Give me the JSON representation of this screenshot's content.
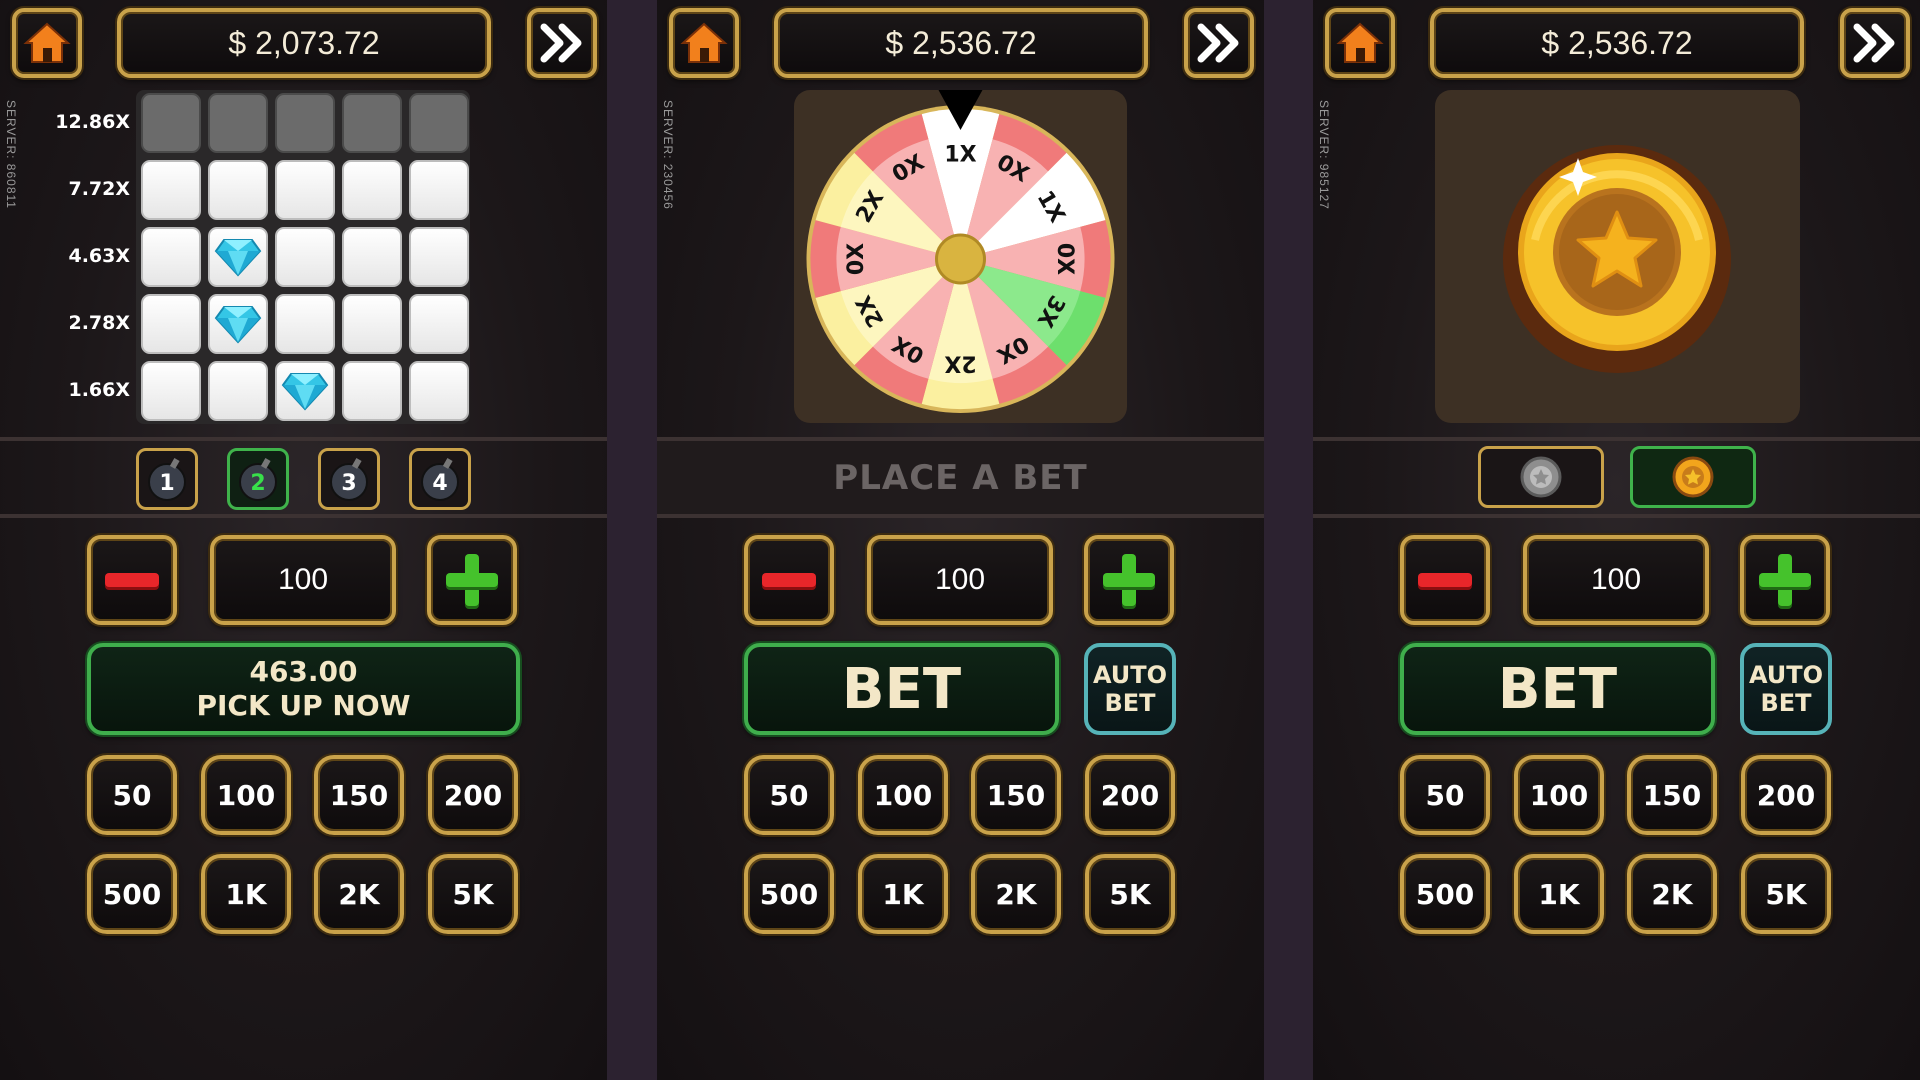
{
  "panels": {
    "mines": {
      "balance": "$  2,073.72",
      "server": "SERVER: 860811",
      "multipliers": [
        "12.86X",
        "7.72X",
        "4.63X",
        "2.78X",
        "1.66X"
      ],
      "bomb_options": [
        "1",
        "2",
        "3",
        "4"
      ],
      "selected_bombs": "2",
      "bet_amount": "100",
      "pickup_amount": "463.00",
      "pickup_label": "PICK UP NOW",
      "chips": [
        "50",
        "100",
        "150",
        "200",
        "500",
        "1K",
        "2K",
        "5K"
      ]
    },
    "wheel": {
      "balance": "$  2,536.72",
      "server": "SERVER: 230456",
      "status": "PLACE A BET",
      "bet_amount": "100",
      "bet_label": "BET",
      "auto_bet": [
        "AUTO",
        "BET"
      ],
      "chips": [
        "50",
        "100",
        "150",
        "200",
        "500",
        "1K",
        "2K",
        "5K"
      ],
      "segments": [
        "1X",
        "0X",
        "1X",
        "0X",
        "3X",
        "0X",
        "2X",
        "0X",
        "2X",
        "0X",
        "2X",
        "0X"
      ]
    },
    "coinflip": {
      "balance": "$  2,536.72",
      "server": "SERVER: 985127",
      "bet_amount": "100",
      "bet_label": "BET",
      "auto_bet": [
        "AUTO",
        "BET"
      ],
      "chips": [
        "50",
        "100",
        "150",
        "200",
        "500",
        "1K",
        "2K",
        "5K"
      ],
      "sides": [
        "silver-coin",
        "gold-coin"
      ],
      "selected_side": "gold-coin"
    }
  },
  "colors": {
    "gold_border": "#c9a24a",
    "green_border": "#3fae4c",
    "minus_red": "#e8262a",
    "plus_green": "#45c22c",
    "auto_cyan": "#56b3b8",
    "wheel_red": "#f07a7a",
    "wheel_yellow": "#fbf0a0",
    "wheel_green": "#6ddf6d"
  }
}
